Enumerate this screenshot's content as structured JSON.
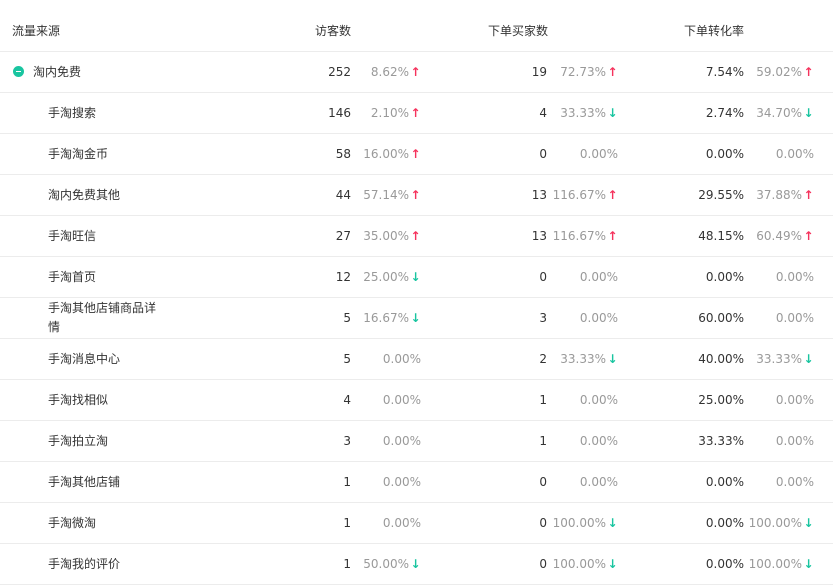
{
  "header": {
    "source": "流量来源",
    "visitors": "访客数",
    "buyers": "下单买家数",
    "conversion": "下单转化率"
  },
  "rows": [
    {
      "name": "淘内免费",
      "group": true,
      "visitors": "252",
      "visitors_change": "8.62%",
      "visitors_trend": "up",
      "buyers": "19",
      "buyers_change": "72.73%",
      "buyers_trend": "up",
      "rate": "7.54%",
      "rate_change": "59.02%",
      "rate_trend": "up"
    },
    {
      "name": "手淘搜索",
      "visitors": "146",
      "visitors_change": "2.10%",
      "visitors_trend": "up",
      "buyers": "4",
      "buyers_change": "33.33%",
      "buyers_trend": "down",
      "rate": "2.74%",
      "rate_change": "34.70%",
      "rate_trend": "down"
    },
    {
      "name": "手淘淘金币",
      "visitors": "58",
      "visitors_change": "16.00%",
      "visitors_trend": "up",
      "buyers": "0",
      "buyers_change": "0.00%",
      "buyers_trend": "none",
      "rate": "0.00%",
      "rate_change": "0.00%",
      "rate_trend": "none"
    },
    {
      "name": "淘内免费其他",
      "visitors": "44",
      "visitors_change": "57.14%",
      "visitors_trend": "up",
      "buyers": "13",
      "buyers_change": "116.67%",
      "buyers_trend": "up",
      "rate": "29.55%",
      "rate_change": "37.88%",
      "rate_trend": "up"
    },
    {
      "name": "手淘旺信",
      "visitors": "27",
      "visitors_change": "35.00%",
      "visitors_trend": "up",
      "buyers": "13",
      "buyers_change": "116.67%",
      "buyers_trend": "up",
      "rate": "48.15%",
      "rate_change": "60.49%",
      "rate_trend": "up"
    },
    {
      "name": "手淘首页",
      "visitors": "12",
      "visitors_change": "25.00%",
      "visitors_trend": "down",
      "buyers": "0",
      "buyers_change": "0.00%",
      "buyers_trend": "none",
      "rate": "0.00%",
      "rate_change": "0.00%",
      "rate_trend": "none"
    },
    {
      "name": "手淘其他店铺商品详情",
      "visitors": "5",
      "visitors_change": "16.67%",
      "visitors_trend": "down",
      "buyers": "3",
      "buyers_change": "0.00%",
      "buyers_trend": "none",
      "rate": "60.00%",
      "rate_change": "0.00%",
      "rate_trend": "none"
    },
    {
      "name": "手淘消息中心",
      "visitors": "5",
      "visitors_change": "0.00%",
      "visitors_trend": "none",
      "buyers": "2",
      "buyers_change": "33.33%",
      "buyers_trend": "down",
      "rate": "40.00%",
      "rate_change": "33.33%",
      "rate_trend": "down"
    },
    {
      "name": "手淘找相似",
      "visitors": "4",
      "visitors_change": "0.00%",
      "visitors_trend": "none",
      "buyers": "1",
      "buyers_change": "0.00%",
      "buyers_trend": "none",
      "rate": "25.00%",
      "rate_change": "0.00%",
      "rate_trend": "none"
    },
    {
      "name": "手淘拍立淘",
      "visitors": "3",
      "visitors_change": "0.00%",
      "visitors_trend": "none",
      "buyers": "1",
      "buyers_change": "0.00%",
      "buyers_trend": "none",
      "rate": "33.33%",
      "rate_change": "0.00%",
      "rate_trend": "none"
    },
    {
      "name": "手淘其他店铺",
      "visitors": "1",
      "visitors_change": "0.00%",
      "visitors_trend": "none",
      "buyers": "0",
      "buyers_change": "0.00%",
      "buyers_trend": "none",
      "rate": "0.00%",
      "rate_change": "0.00%",
      "rate_trend": "none"
    },
    {
      "name": "手淘微淘",
      "visitors": "1",
      "visitors_change": "0.00%",
      "visitors_trend": "none",
      "buyers": "0",
      "buyers_change": "100.00%",
      "buyers_trend": "down",
      "rate": "0.00%",
      "rate_change": "100.00%",
      "rate_trend": "down"
    },
    {
      "name": "手淘我的评价",
      "visitors": "1",
      "visitors_change": "50.00%",
      "visitors_trend": "down",
      "buyers": "0",
      "buyers_change": "100.00%",
      "buyers_trend": "down",
      "rate": "0.00%",
      "rate_change": "100.00%",
      "rate_trend": "down"
    }
  ],
  "icons": {
    "up": "arrow-up-icon",
    "down": "arrow-down-icon",
    "collapse": "collapse-minus-icon"
  },
  "colors": {
    "up": "#f5325c",
    "down": "#19c5a0",
    "accent": "#19c5a0",
    "muted": "#999999"
  }
}
